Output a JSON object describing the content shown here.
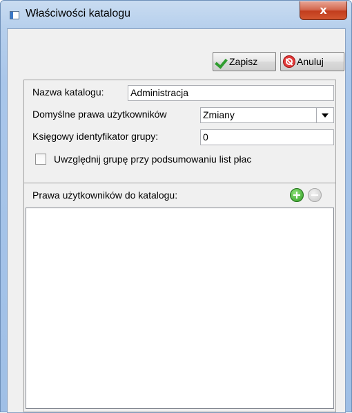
{
  "window": {
    "title": "Właściwości katalogu",
    "close_label": "x"
  },
  "toolbar": {
    "save_label": "Zapisz",
    "cancel_label": "Anuluj"
  },
  "form": {
    "name_label": "Nazwa katalogu:",
    "name_value": "Administracja",
    "default_rights_label": "Domyślne prawa użytkowników",
    "default_rights_value": "Zmiany",
    "account_id_label": "Księgowy identyfikator grupy:",
    "account_id_value": "0",
    "include_checkbox_label": "Uwzględnij grupę przy podsumowaniu list płac",
    "include_checked": false
  },
  "rights": {
    "header_label": "Prawa użytkowników do katalogu:",
    "items": []
  }
}
